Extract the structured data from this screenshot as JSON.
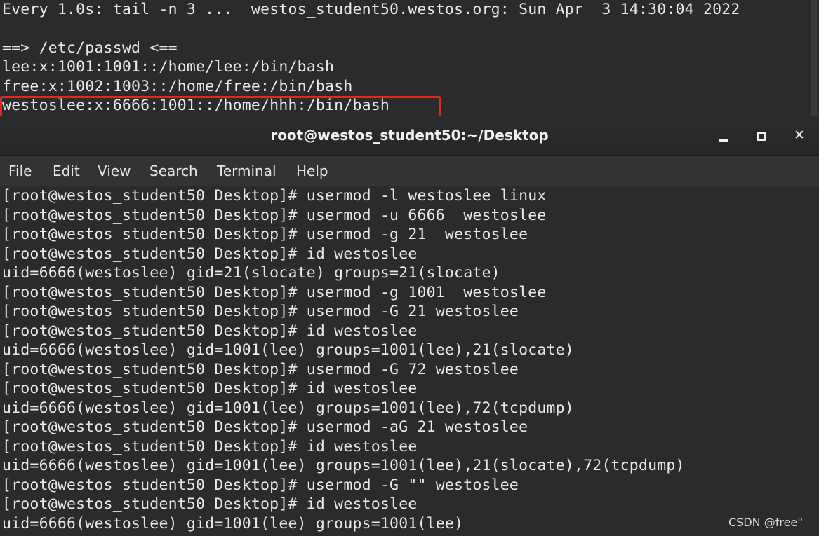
{
  "back_terminal": {
    "lines": [
      "Every 1.0s: tail -n 3 ...  westos_student50.westos.org: Sun Apr  3 14:30:04 2022",
      "",
      "==> /etc/passwd <==",
      "lee:x:1001:1001::/home/lee:/bin/bash",
      "free:x:1002:1003::/home/free:/bin/bash",
      "westoslee:x:6666:1001::/home/hhh:/bin/bash"
    ]
  },
  "window": {
    "title": "root@westos_student50:~/Desktop",
    "minimize_icon": "minimize-icon",
    "maximize_icon": "maximize-icon",
    "close_icon": "close-icon",
    "close_glyph": "✕"
  },
  "menu": {
    "items": [
      "File",
      "Edit",
      "View",
      "Search",
      "Terminal",
      "Help"
    ]
  },
  "terminal": {
    "lines": [
      "[root@westos_student50 Desktop]# usermod -l westoslee linux",
      "[root@westos_student50 Desktop]# usermod -u 6666  westoslee",
      "[root@westos_student50 Desktop]# usermod -g 21  westoslee",
      "[root@westos_student50 Desktop]# id westoslee",
      "uid=6666(westoslee) gid=21(slocate) groups=21(slocate)",
      "[root@westos_student50 Desktop]# usermod -g 1001  westoslee",
      "[root@westos_student50 Desktop]# usermod -G 21 westoslee",
      "[root@westos_student50 Desktop]# id westoslee",
      "uid=6666(westoslee) gid=1001(lee) groups=1001(lee),21(slocate)",
      "[root@westos_student50 Desktop]# usermod -G 72 westoslee",
      "[root@westos_student50 Desktop]# id westoslee",
      "uid=6666(westoslee) gid=1001(lee) groups=1001(lee),72(tcpdump)",
      "[root@westos_student50 Desktop]# usermod -aG 21 westoslee",
      "[root@westos_student50 Desktop]# id westoslee",
      "uid=6666(westoslee) gid=1001(lee) groups=1001(lee),21(slocate),72(tcpdump)",
      "[root@westos_student50 Desktop]# usermod -G \"\" westoslee",
      "[root@westos_student50 Desktop]# id westoslee",
      "uid=6666(westoslee) gid=1001(lee) groups=1001(lee)"
    ]
  },
  "watermark": "CSDN @free°",
  "colors": {
    "highlight_border": "#e3261f",
    "terminal_bg": "#2b2b2b",
    "text": "#e6e6e6"
  }
}
